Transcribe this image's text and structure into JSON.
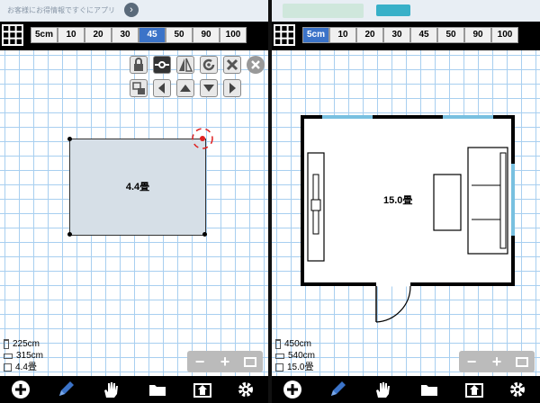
{
  "left": {
    "ad_text": "お客様にお得情報ですぐにアプリ",
    "ad_arrow": "›",
    "scales": [
      "5cm",
      "10",
      "20",
      "30",
      "45",
      "50",
      "90",
      "100"
    ],
    "selected_scale": "45",
    "room_area": "4.4畳",
    "dims": {
      "width": "225cm",
      "depth": "315cm",
      "area": "4.4畳"
    },
    "zoom": {
      "minus": "−",
      "plus": "+"
    }
  },
  "right": {
    "scales": [
      "5cm",
      "10",
      "20",
      "30",
      "45",
      "50",
      "90",
      "100"
    ],
    "selected_scale": "5cm",
    "room_area": "15.0畳",
    "dims": {
      "width": "450cm",
      "depth": "540cm",
      "area": "15.0畳"
    },
    "zoom": {
      "minus": "−",
      "plus": "+"
    }
  },
  "colors": {
    "accent": "#3b73c8",
    "grid": "#a8cff0",
    "room_fill": "#d6dfe7",
    "window": "#78c0e0",
    "handle": "#e02020"
  }
}
